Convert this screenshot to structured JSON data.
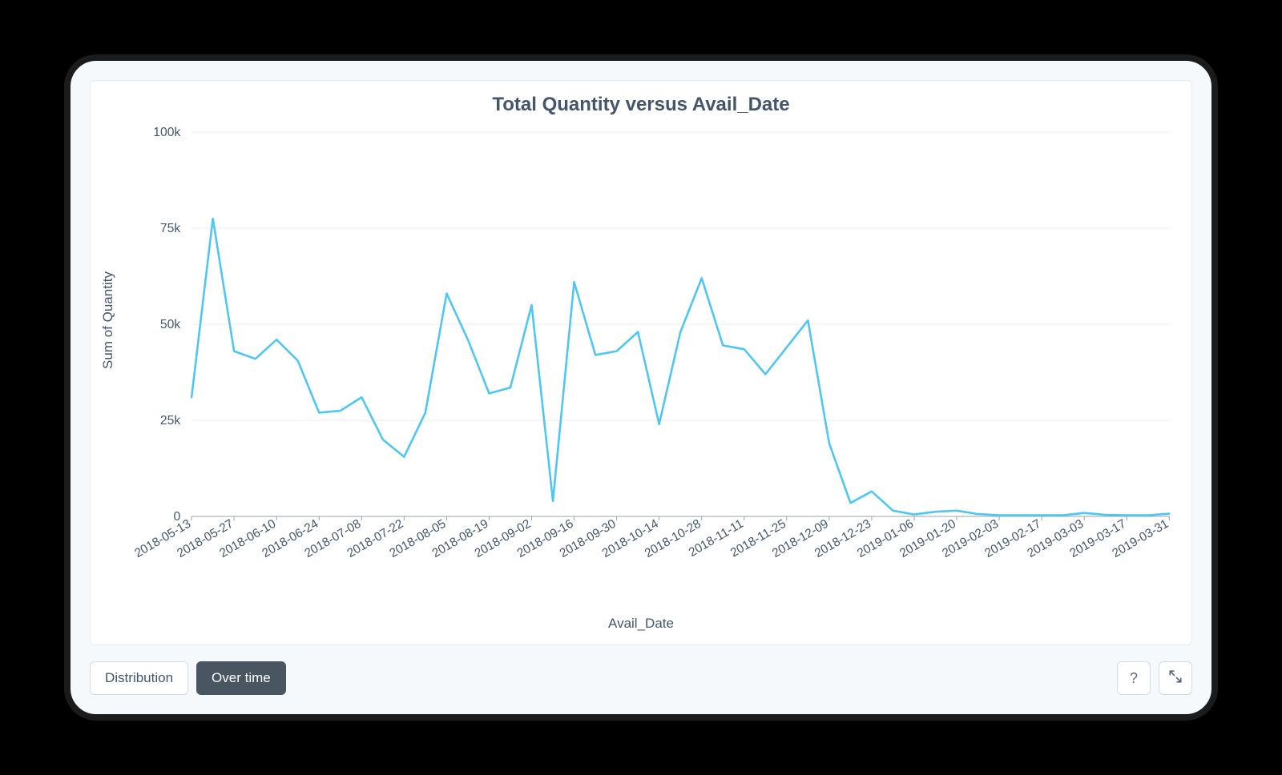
{
  "chart_data": {
    "type": "line",
    "title": "Total Quantity versus Avail_Date",
    "xlabel": "Avail_Date",
    "ylabel": "Sum of Quantity",
    "ylim": [
      0,
      100000
    ],
    "y_ticks": [
      0,
      25000,
      50000,
      75000,
      100000
    ],
    "y_tick_labels": [
      "0",
      "25k",
      "50k",
      "75k",
      "100k"
    ],
    "x_tick_labels": [
      "2018-05-13",
      "2018-05-27",
      "2018-06-10",
      "2018-06-24",
      "2018-07-08",
      "2018-07-22",
      "2018-08-05",
      "2018-08-19",
      "2018-09-02",
      "2018-09-16",
      "2018-09-30",
      "2018-10-14",
      "2018-10-28",
      "2018-11-11",
      "2018-11-25",
      "2018-12-09",
      "2018-12-23",
      "2019-01-06",
      "2019-01-20",
      "2019-02-03",
      "2019-02-17",
      "2019-03-03",
      "2019-03-17",
      "2019-03-31"
    ],
    "series": [
      {
        "name": "Sum of Quantity",
        "color": "#4ec6f2",
        "x": [
          "2018-05-13",
          "2018-05-20",
          "2018-05-27",
          "2018-06-03",
          "2018-06-10",
          "2018-06-17",
          "2018-06-24",
          "2018-07-01",
          "2018-07-08",
          "2018-07-15",
          "2018-07-22",
          "2018-07-29",
          "2018-08-05",
          "2018-08-12",
          "2018-08-19",
          "2018-08-26",
          "2018-09-02",
          "2018-09-09",
          "2018-09-16",
          "2018-09-23",
          "2018-09-30",
          "2018-10-07",
          "2018-10-14",
          "2018-10-21",
          "2018-10-28",
          "2018-11-04",
          "2018-11-11",
          "2018-11-18",
          "2018-11-25",
          "2018-12-02",
          "2018-12-09",
          "2018-12-16",
          "2018-12-23",
          "2018-12-30",
          "2019-01-06",
          "2019-01-13",
          "2019-01-20",
          "2019-01-27",
          "2019-02-03",
          "2019-02-10",
          "2019-02-17",
          "2019-02-24",
          "2019-03-03",
          "2019-03-10",
          "2019-03-17",
          "2019-03-24",
          "2019-03-31"
        ],
        "values": [
          31000,
          77500,
          43000,
          41000,
          46000,
          40500,
          27000,
          27500,
          31000,
          20000,
          15500,
          27000,
          58000,
          46000,
          32000,
          33500,
          55000,
          4000,
          61000,
          42000,
          43000,
          48000,
          24000,
          48000,
          62000,
          44500,
          43500,
          37000,
          44000,
          51000,
          19000,
          3500,
          6500,
          1500,
          500,
          1200,
          1500,
          600,
          300,
          300,
          300,
          300,
          900,
          400,
          300,
          300,
          700
        ]
      }
    ]
  },
  "controls": {
    "distribution_label": "Distribution",
    "over_time_label": "Over time",
    "help_label": "?",
    "expand_label": "expand"
  }
}
